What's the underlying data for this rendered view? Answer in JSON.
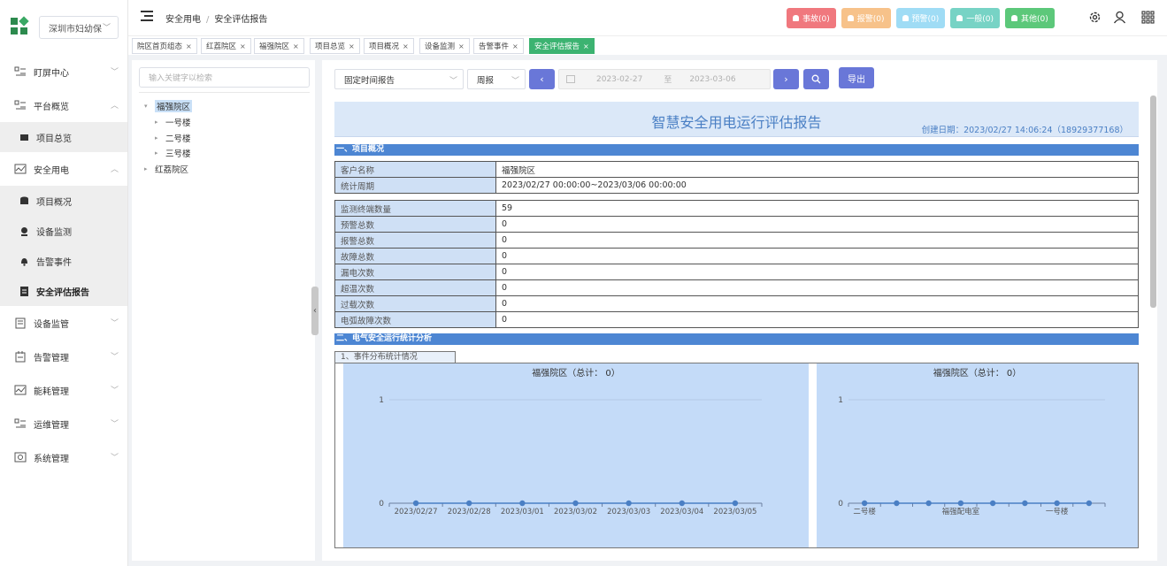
{
  "sidebar": {
    "org_select": "深圳市妇幼保",
    "menu": [
      {
        "label": "盯屏中心",
        "icon": "monitor-list-icon"
      },
      {
        "label": "平台概览",
        "icon": "platform-overview-icon"
      },
      {
        "label": "项目总览",
        "icon": "project-overview-icon",
        "sub": true
      },
      {
        "label": "安全用电",
        "icon": "safe-electricity-icon"
      },
      {
        "label": "项目概况",
        "icon": "database-icon",
        "sub": true
      },
      {
        "label": "设备监测",
        "icon": "monitor-device-icon",
        "sub": true
      },
      {
        "label": "告警事件",
        "icon": "bell-icon",
        "sub": true
      },
      {
        "label": "安全评估报告",
        "icon": "report-icon",
        "sub": true,
        "active": true
      },
      {
        "label": "设备监管",
        "icon": "device-supervision-icon"
      },
      {
        "label": "告警管理",
        "icon": "alarm-management-icon"
      },
      {
        "label": "能耗管理",
        "icon": "energy-management-icon"
      },
      {
        "label": "运维管理",
        "icon": "ops-management-icon"
      },
      {
        "label": "系统管理",
        "icon": "system-management-icon"
      }
    ]
  },
  "header": {
    "breadcrumb": [
      "安全用电",
      "安全评估报告"
    ],
    "badges": [
      {
        "label": "事故(0)",
        "color": "#f0787e"
      },
      {
        "label": "报警(0)",
        "color": "#f7c28a"
      },
      {
        "label": "预警(0)",
        "color": "#9fdcf5"
      },
      {
        "label": "一般(0)",
        "color": "#77d3c5"
      },
      {
        "label": "其他(0)",
        "color": "#5cc87a"
      }
    ]
  },
  "tabs": [
    "院区首页组态",
    "红荔院区",
    "福强院区",
    "项目总览",
    "项目概况",
    "设备监测",
    "告警事件",
    "安全评估报告"
  ],
  "tree": {
    "search_placeholder": "输入关键字以检索",
    "nodes": [
      "福强院区",
      "一号楼",
      "二号楼",
      "三号楼",
      "红荔院区"
    ]
  },
  "filters": {
    "report_type": "固定时间报告",
    "period": "周报",
    "start_date": "2023-02-27",
    "range_sep": "至",
    "end_date": "2023-03-06",
    "export_label": "导出"
  },
  "report": {
    "title": "智慧安全用电运行评估报告",
    "created": "创建日期：2023/02/27 14:06:24（18929377168）",
    "section1": "一、项目概况",
    "info": [
      {
        "k": "客户名称",
        "v": "福强院区"
      },
      {
        "k": "统计周期",
        "v": "2023/02/27 00:00:00~2023/03/06 00:00:00"
      }
    ],
    "stats": [
      {
        "k": "监测终端数量",
        "v": "59"
      },
      {
        "k": "预警总数",
        "v": "0"
      },
      {
        "k": "报警总数",
        "v": "0"
      },
      {
        "k": "故障总数",
        "v": "0"
      },
      {
        "k": "漏电次数",
        "v": "0"
      },
      {
        "k": "超温次数",
        "v": "0"
      },
      {
        "k": "过载次数",
        "v": "0"
      },
      {
        "k": "电弧故障次数",
        "v": "0"
      }
    ],
    "section2": "二、电气安全运行统计分析",
    "sub1": "1、事件分布统计情况"
  },
  "chart_data": [
    {
      "type": "line",
      "title": "福强院区（总计： 0）",
      "x": [
        "2023/02/27",
        "2023/02/28",
        "2023/03/01",
        "2023/03/02",
        "2023/03/03",
        "2023/03/04",
        "2023/03/05"
      ],
      "values": [
        0,
        0,
        0,
        0,
        0,
        0,
        0
      ],
      "ylim": [
        0,
        1
      ],
      "yticks": [
        "0",
        "1"
      ],
      "color": "#4a7fc4"
    },
    {
      "type": "line",
      "title": "福强院区（总计： 0）",
      "x": [
        "二号楼",
        "",
        "",
        "福强配电室",
        "",
        "",
        "一号楼",
        ""
      ],
      "values": [
        0,
        0,
        0,
        0,
        0,
        0,
        0,
        0
      ],
      "ylim": [
        0,
        1
      ],
      "yticks": [
        "0",
        "1"
      ],
      "color": "#4a7fc4"
    }
  ]
}
